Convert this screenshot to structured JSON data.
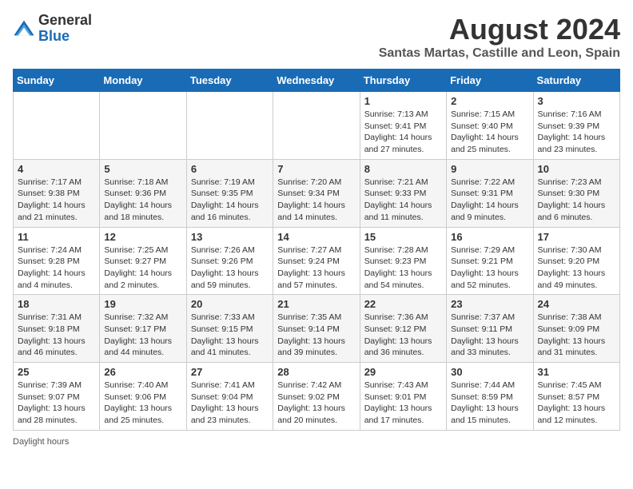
{
  "logo": {
    "general": "General",
    "blue": "Blue"
  },
  "title": "August 2024",
  "subtitle": "Santas Martas, Castille and Leon, Spain",
  "days_of_week": [
    "Sunday",
    "Monday",
    "Tuesday",
    "Wednesday",
    "Thursday",
    "Friday",
    "Saturday"
  ],
  "weeks": [
    [
      {
        "day": "",
        "detail": ""
      },
      {
        "day": "",
        "detail": ""
      },
      {
        "day": "",
        "detail": ""
      },
      {
        "day": "",
        "detail": ""
      },
      {
        "day": "1",
        "detail": "Sunrise: 7:13 AM\nSunset: 9:41 PM\nDaylight: 14 hours and 27 minutes."
      },
      {
        "day": "2",
        "detail": "Sunrise: 7:15 AM\nSunset: 9:40 PM\nDaylight: 14 hours and 25 minutes."
      },
      {
        "day": "3",
        "detail": "Sunrise: 7:16 AM\nSunset: 9:39 PM\nDaylight: 14 hours and 23 minutes."
      }
    ],
    [
      {
        "day": "4",
        "detail": "Sunrise: 7:17 AM\nSunset: 9:38 PM\nDaylight: 14 hours and 21 minutes."
      },
      {
        "day": "5",
        "detail": "Sunrise: 7:18 AM\nSunset: 9:36 PM\nDaylight: 14 hours and 18 minutes."
      },
      {
        "day": "6",
        "detail": "Sunrise: 7:19 AM\nSunset: 9:35 PM\nDaylight: 14 hours and 16 minutes."
      },
      {
        "day": "7",
        "detail": "Sunrise: 7:20 AM\nSunset: 9:34 PM\nDaylight: 14 hours and 14 minutes."
      },
      {
        "day": "8",
        "detail": "Sunrise: 7:21 AM\nSunset: 9:33 PM\nDaylight: 14 hours and 11 minutes."
      },
      {
        "day": "9",
        "detail": "Sunrise: 7:22 AM\nSunset: 9:31 PM\nDaylight: 14 hours and 9 minutes."
      },
      {
        "day": "10",
        "detail": "Sunrise: 7:23 AM\nSunset: 9:30 PM\nDaylight: 14 hours and 6 minutes."
      }
    ],
    [
      {
        "day": "11",
        "detail": "Sunrise: 7:24 AM\nSunset: 9:28 PM\nDaylight: 14 hours and 4 minutes."
      },
      {
        "day": "12",
        "detail": "Sunrise: 7:25 AM\nSunset: 9:27 PM\nDaylight: 14 hours and 2 minutes."
      },
      {
        "day": "13",
        "detail": "Sunrise: 7:26 AM\nSunset: 9:26 PM\nDaylight: 13 hours and 59 minutes."
      },
      {
        "day": "14",
        "detail": "Sunrise: 7:27 AM\nSunset: 9:24 PM\nDaylight: 13 hours and 57 minutes."
      },
      {
        "day": "15",
        "detail": "Sunrise: 7:28 AM\nSunset: 9:23 PM\nDaylight: 13 hours and 54 minutes."
      },
      {
        "day": "16",
        "detail": "Sunrise: 7:29 AM\nSunset: 9:21 PM\nDaylight: 13 hours and 52 minutes."
      },
      {
        "day": "17",
        "detail": "Sunrise: 7:30 AM\nSunset: 9:20 PM\nDaylight: 13 hours and 49 minutes."
      }
    ],
    [
      {
        "day": "18",
        "detail": "Sunrise: 7:31 AM\nSunset: 9:18 PM\nDaylight: 13 hours and 46 minutes."
      },
      {
        "day": "19",
        "detail": "Sunrise: 7:32 AM\nSunset: 9:17 PM\nDaylight: 13 hours and 44 minutes."
      },
      {
        "day": "20",
        "detail": "Sunrise: 7:33 AM\nSunset: 9:15 PM\nDaylight: 13 hours and 41 minutes."
      },
      {
        "day": "21",
        "detail": "Sunrise: 7:35 AM\nSunset: 9:14 PM\nDaylight: 13 hours and 39 minutes."
      },
      {
        "day": "22",
        "detail": "Sunrise: 7:36 AM\nSunset: 9:12 PM\nDaylight: 13 hours and 36 minutes."
      },
      {
        "day": "23",
        "detail": "Sunrise: 7:37 AM\nSunset: 9:11 PM\nDaylight: 13 hours and 33 minutes."
      },
      {
        "day": "24",
        "detail": "Sunrise: 7:38 AM\nSunset: 9:09 PM\nDaylight: 13 hours and 31 minutes."
      }
    ],
    [
      {
        "day": "25",
        "detail": "Sunrise: 7:39 AM\nSunset: 9:07 PM\nDaylight: 13 hours and 28 minutes."
      },
      {
        "day": "26",
        "detail": "Sunrise: 7:40 AM\nSunset: 9:06 PM\nDaylight: 13 hours and 25 minutes."
      },
      {
        "day": "27",
        "detail": "Sunrise: 7:41 AM\nSunset: 9:04 PM\nDaylight: 13 hours and 23 minutes."
      },
      {
        "day": "28",
        "detail": "Sunrise: 7:42 AM\nSunset: 9:02 PM\nDaylight: 13 hours and 20 minutes."
      },
      {
        "day": "29",
        "detail": "Sunrise: 7:43 AM\nSunset: 9:01 PM\nDaylight: 13 hours and 17 minutes."
      },
      {
        "day": "30",
        "detail": "Sunrise: 7:44 AM\nSunset: 8:59 PM\nDaylight: 13 hours and 15 minutes."
      },
      {
        "day": "31",
        "detail": "Sunrise: 7:45 AM\nSunset: 8:57 PM\nDaylight: 13 hours and 12 minutes."
      }
    ]
  ],
  "footer": "Daylight hours"
}
